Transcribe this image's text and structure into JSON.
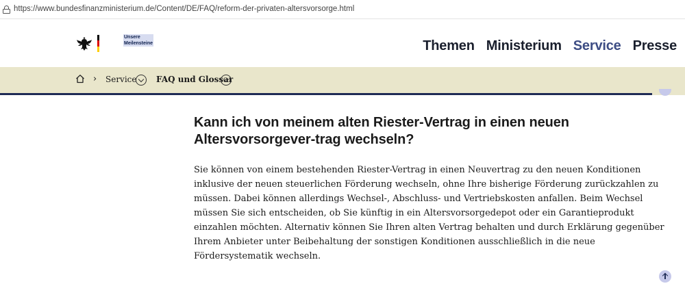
{
  "browser": {
    "url": "https://www.bundesfinanzministerium.de/Content/DE/FAQ/reform-der-privaten-altersvorsorge.html"
  },
  "header": {
    "milestones_line1": "Unsere",
    "milestones_line2": "Meilensteine",
    "nav": [
      "Themen",
      "Ministerium",
      "Service",
      "Presse"
    ],
    "active_nav": "Service"
  },
  "breadcrumb": {
    "items": [
      "Service",
      "FAQ und Glossar"
    ],
    "separator": "›"
  },
  "content": {
    "question": "Kann ich von meinem alten Riester-Vertrag in einen neuen Altersvorsorgever-trag wechseln?",
    "answer": "Sie können von einem bestehenden Riester-Vertrag in einen Neuvertrag zu den neuen Konditionen inklusive der neuen steuerlichen Förderung wechseln, ohne Ihre bisherige Förderung zurückzahlen zu müssen. Dabei können allerdings Wechsel-, Abschluss- und Vertriebskosten anfallen. Beim Wechsel müssen Sie sich entscheiden, ob Sie künftig in ein Altersvorsorgedepot oder ein Garantieprodukt einzahlen möchten. Alternativ können Sie Ihren alten Vertrag behalten und durch Erklärung gegenüber Ihrem Anbieter unter Beibehaltung der sonstigen Konditionen ausschließlich in die neue Fördersystematik wechseln."
  },
  "colors": {
    "nav_active": "#3d4d84",
    "breadcrumb_bg": "#e9e6cb",
    "progress": "#1e2b55",
    "accent_light": "#c6c9ea"
  },
  "icons": {
    "lock": "lock-icon",
    "eagle": "federal-eagle-icon",
    "home": "home-icon",
    "chevron": "chevron-down-circle-icon",
    "to_top": "arrow-up-icon"
  }
}
